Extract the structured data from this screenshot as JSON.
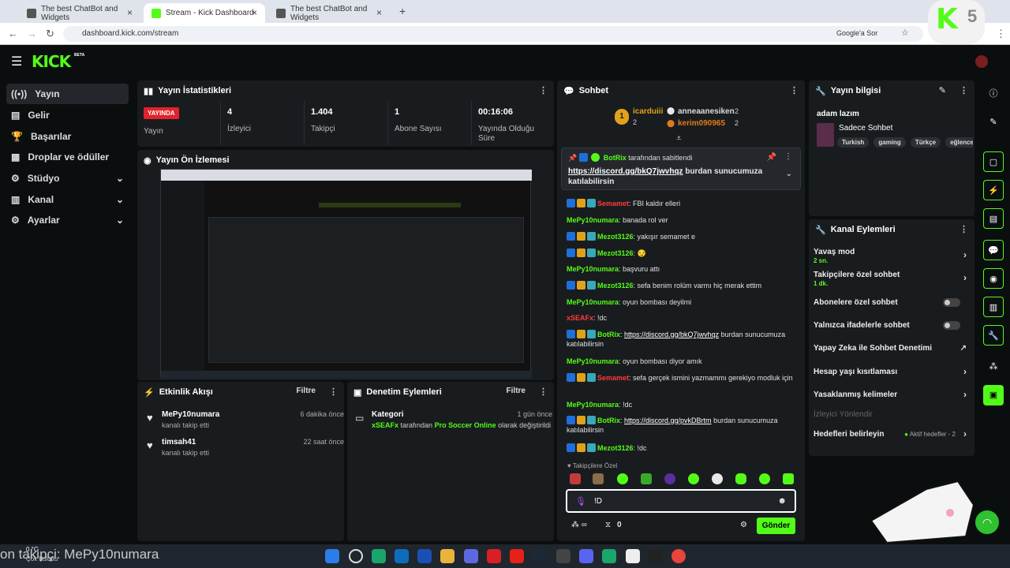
{
  "browser": {
    "tabs": [
      {
        "title": "The best ChatBot and Widgets"
      },
      {
        "title": "Stream - Kick Dashboard"
      },
      {
        "title": "The best ChatBot and Widgets"
      }
    ],
    "url": "dashboard.kick.com/stream",
    "google_ask": "Google'a Sor"
  },
  "kick": {
    "logo": "KICK",
    "beta": "BETA"
  },
  "sidebar": {
    "items": [
      {
        "label": "Yayın"
      },
      {
        "label": "Gelir"
      },
      {
        "label": "Başarılar"
      },
      {
        "label": "Droplar ve ödüller"
      },
      {
        "label": "Stüdyo"
      },
      {
        "label": "Kanal"
      },
      {
        "label": "Ayarlar"
      }
    ]
  },
  "stats": {
    "title": "Yayın İstatistikleri",
    "live_badge": "YAYINDA",
    "cells": [
      {
        "value": "",
        "label": "Yayın"
      },
      {
        "value": "4",
        "label": "İzleyici"
      },
      {
        "value": "1.404",
        "label": "Takipçi"
      },
      {
        "value": "1",
        "label": "Abone Sayısı"
      },
      {
        "value": "00:16:06",
        "label": "Yayında Olduğu Süre"
      }
    ]
  },
  "preview": {
    "title": "Yayın Ön İzlemesi"
  },
  "activity": {
    "title": "Etkinlik Akışı",
    "filter": "Filtre",
    "events": [
      {
        "name": "MePy10numara",
        "sub": "kanalı takip etti",
        "time": "6 dakika önce"
      },
      {
        "name": "timsah41",
        "sub": "kanalı takip etti",
        "time": "22 saat önce"
      }
    ]
  },
  "moderation": {
    "title": "Denetim Eylemleri",
    "filter": "Filtre",
    "item": {
      "title": "Kategori",
      "time": "1 gün önce",
      "user": "xSEAFx",
      "mid": "tarafından",
      "game": "Pro Soccer Online",
      "end": "olarak değiştirildi"
    }
  },
  "chat": {
    "title": "Sohbet",
    "top": [
      {
        "rank": "1",
        "name": "icarduiii",
        "count": "2"
      },
      {
        "name": "anneaanesiken",
        "count": "2"
      },
      {
        "name": "kerim090965",
        "count": "2"
      }
    ],
    "pinned": {
      "by": "BotRix",
      "by_suffix": "tarafından sabitlendi",
      "link": "https://discord.gg/bkQ7jwvhqz",
      "text": "burdan sunucumuza katılabilirsin"
    },
    "messages": [
      {
        "user": "Semamet",
        "color": "#ff3b3b",
        "text": "FBI kaldır elleri"
      },
      {
        "user": "MePy10numara",
        "color": "#53fc18",
        "text": "banada rol ver"
      },
      {
        "user": "Mezot3126",
        "color": "#53fc18",
        "text": "yakışır semamet e"
      },
      {
        "user": "Mezot3126",
        "color": "#53fc18",
        "text": "😏"
      },
      {
        "user": "MePy10numara",
        "color": "#53fc18",
        "text": "başvuru attı"
      },
      {
        "user": "Mezot3126",
        "color": "#53fc18",
        "text": "sefa benim rolüm varmı hiç merak ettim"
      },
      {
        "user": "MePy10numara",
        "color": "#53fc18",
        "text": "oyun bombası deyilmi"
      },
      {
        "user": "xSEAFx",
        "color": "#ff3b3b",
        "text": "!dc"
      },
      {
        "user": "BotRix",
        "color": "#53fc18",
        "link": "https://discord.gg/bkQ7jwvhqz",
        "text": "burdan sunucumuza katılabilirsin"
      },
      {
        "user": "MePy10numara",
        "color": "#53fc18",
        "text": "oyun bombası diyor amık"
      },
      {
        "user": "Semamet",
        "color": "#ff3b3b",
        "text": "sefa gerçek ismini yazmammı gerekiyo modluk için"
      },
      {
        "user": "MePy10numara",
        "color": "#53fc18",
        "text": "!dc"
      },
      {
        "user": "BotRix",
        "color": "#53fc18",
        "link": "https://discord.gg/pvkDBrtm",
        "text": "burdan sunucumuza katılabilirsin"
      },
      {
        "user": "Mezot3126",
        "color": "#53fc18",
        "text": "!dc"
      }
    ],
    "followers_only": "Takipçilere Özel",
    "input_value": "!D",
    "count": "0",
    "send": "Gönder"
  },
  "stream_info": {
    "title": "Yayın bilgisi",
    "stream_title": "adam lazım",
    "category": "Sadece Sohbet",
    "tags": [
      "Turkish",
      "gaming",
      "Türkçe",
      "eğlence"
    ]
  },
  "channel_actions": {
    "title": "Kanal Eylemleri",
    "rows": [
      {
        "label": "Yavaş mod",
        "sub": "2 sn."
      },
      {
        "label": "Takipçilere özel sohbet",
        "sub": "1 dk."
      },
      {
        "label": "Abonelere özel sohbet"
      },
      {
        "label": "Yalnızca ifadelerle sohbet"
      },
      {
        "label": "Yapay Zeka ile Sohbet Denetimi"
      },
      {
        "label": "Hesap yaşı kısıtlaması"
      },
      {
        "label": "Yasaklanmış kelimeler"
      },
      {
        "label": "İzleyici Yönlendir"
      },
      {
        "label": "Hedefleri belirleyin",
        "extra": "Aktif hedefler - 2"
      }
    ]
  },
  "taskbar": {
    "weather": "0 °C",
    "weather_sub": "Çok bulutlu",
    "overlay": "on takipçi: MePy10numara"
  },
  "colors": {
    "accent": "#53fc18",
    "live": "#e0232c",
    "panel": "#191c1f"
  }
}
